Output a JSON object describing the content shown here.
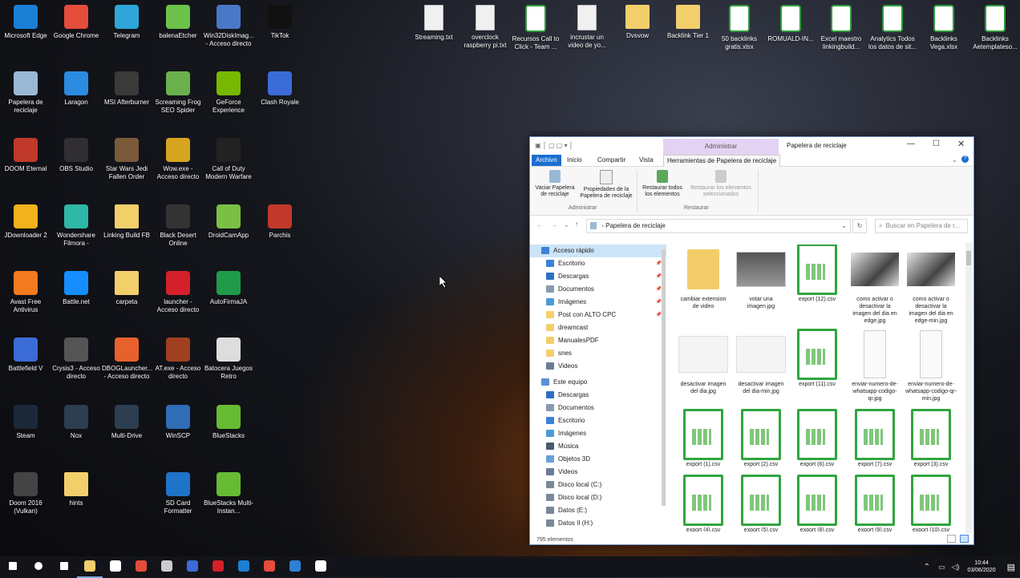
{
  "desktop": {
    "icons": [
      {
        "label": "Microsoft Edge",
        "icon": "edge-icon",
        "color": "#1b7fd6"
      },
      {
        "label": "Google Chrome",
        "icon": "chrome-icon",
        "color": "#e44c3c"
      },
      {
        "label": "Telegram",
        "icon": "telegram-icon",
        "color": "#2ea6da"
      },
      {
        "label": "balenaEtcher",
        "icon": "etcher-icon",
        "color": "#6cc24a"
      },
      {
        "label": "Win32DiskImag... - Acceso directo",
        "icon": "disk-imager-icon",
        "color": "#4a78c9"
      },
      {
        "label": "TikTok",
        "icon": "tiktok-icon",
        "color": "#111111"
      },
      {
        "label": "Papelera de reciclaje",
        "icon": "recycle-bin-icon",
        "color": "#9ab8d6"
      },
      {
        "label": "Laragon",
        "icon": "laragon-icon",
        "color": "#2b8be0"
      },
      {
        "label": "MSI Afterburner",
        "icon": "afterburner-icon",
        "color": "#3a3a3a"
      },
      {
        "label": "Screaming Frog SEO Spider",
        "icon": "screaming-frog-icon",
        "color": "#6ab04c"
      },
      {
        "label": "GeForce Experience",
        "icon": "geforce-icon",
        "color": "#76b900"
      },
      {
        "label": "Clash Royale",
        "icon": "clash-royale-icon",
        "color": "#3b6bd6"
      },
      {
        "label": "DOOM Eternal",
        "icon": "doom-icon",
        "color": "#c0392b"
      },
      {
        "label": "OBS Studio",
        "icon": "obs-icon",
        "color": "#302e31"
      },
      {
        "label": "Star Wars Jedi Fallen Order",
        "icon": "star-wars-icon",
        "color": "#7a5a3a"
      },
      {
        "label": "Wow.exe - Acceso directo",
        "icon": "wow-icon",
        "color": "#d6a520"
      },
      {
        "label": "Call of Duty Modern Warfare",
        "icon": "cod-icon",
        "color": "#222222"
      },
      {
        "label": "JDownloader 2",
        "icon": "jdownloader-icon",
        "color": "#f2b21b"
      },
      {
        "label": "Wondershare Filmora -",
        "icon": "filmora-icon",
        "color": "#2fb8a8"
      },
      {
        "label": "Linking Build FB",
        "icon": "folder-icon",
        "color": "#f3cf6c"
      },
      {
        "label": "Black Desert Online",
        "icon": "black-desert-icon",
        "color": "#333333"
      },
      {
        "label": "DroidCamApp",
        "icon": "droidcam-icon",
        "color": "#7cc043"
      },
      {
        "label": "Parchis",
        "icon": "parchis-icon",
        "color": "#c0392b"
      },
      {
        "label": "Avast Free Antivirus",
        "icon": "avast-icon",
        "color": "#f47a20"
      },
      {
        "label": "Battle.net",
        "icon": "battlenet-icon",
        "color": "#148eff"
      },
      {
        "label": "carpeta",
        "icon": "folder-icon",
        "color": "#f3cf6c"
      },
      {
        "label": "launcher - Acceso directo",
        "icon": "opera-icon",
        "color": "#d3202a"
      },
      {
        "label": "AutoFirmaJA",
        "icon": "autofirma-icon",
        "color": "#1f9b4a"
      },
      {
        "label": "Battlefield V",
        "icon": "battlefield-icon",
        "color": "#3b6bd6"
      },
      {
        "label": "Crysis3 - Acceso directo",
        "icon": "crysis-icon",
        "color": "#555555"
      },
      {
        "label": "DBOGLauncher... - Acceso directo",
        "icon": "dbog-icon",
        "color": "#e8612c"
      },
      {
        "label": "AT.exe - Acceso directo",
        "icon": "at-icon",
        "color": "#a04020"
      },
      {
        "label": "Batocera Juegos Retro",
        "icon": "batocera-icon",
        "color": "#dddddd"
      },
      {
        "label": "Steam",
        "icon": "steam-icon",
        "color": "#1b2838"
      },
      {
        "label": "Nox",
        "icon": "nox-icon",
        "color": "#2c3e50"
      },
      {
        "label": "Multi-Drive",
        "icon": "multidrive-icon",
        "color": "#2c3e50"
      },
      {
        "label": "WinSCP",
        "icon": "winscp-icon",
        "color": "#2f6db5"
      },
      {
        "label": "BlueStacks",
        "icon": "bluestacks-icon",
        "color": "#66bb33"
      },
      {
        "label": "Doom 2016 (Vulkan)",
        "icon": "doom2016-icon",
        "color": "#444444"
      },
      {
        "label": "hints",
        "icon": "folder-icon",
        "color": "#f3cf6c"
      },
      {
        "label": "SD Card Formatter",
        "icon": "sd-card-icon",
        "color": "#1f73c9"
      },
      {
        "label": "BlueStacks Multi-Instan...",
        "icon": "bluestacks-multi-icon",
        "color": "#66bb33"
      }
    ],
    "top_files": [
      {
        "label": "Streaming.txt",
        "kind": "doc"
      },
      {
        "label": "overclock raspberry pi.txt",
        "kind": "doc"
      },
      {
        "label": "Recursos Call to Click - Team ...",
        "kind": "xls"
      },
      {
        "label": "incrustar un video de yo...",
        "kind": "doc"
      },
      {
        "label": "Dvsvow",
        "kind": "fold"
      },
      {
        "label": "Backlink Tier 1",
        "kind": "fold"
      },
      {
        "label": "50 backlinks gratis.xlsx",
        "kind": "xls"
      },
      {
        "label": "ROMUALD-IN...",
        "kind": "xls"
      },
      {
        "label": "Excel maestro linkingbuild...",
        "kind": "xls"
      },
      {
        "label": "Analytics Todos los datos de sit...",
        "kind": "xls"
      },
      {
        "label": "Backlinks Vega.xlsx",
        "kind": "xls"
      },
      {
        "label": "Backlinks Aetemplateso...",
        "kind": "xls"
      }
    ]
  },
  "explorer": {
    "title": "Papelera de reciclaje",
    "context_tab_header": "Administrar",
    "ribbon_tabs": [
      "Archivo",
      "Inicio",
      "Compartir",
      "Vista",
      "Herramientas de Papelera de reciclaje"
    ],
    "ribbon_buttons": [
      {
        "label": "Vaciar Papelera de reciclaje"
      },
      {
        "label": "Propiedades de la Papelera de reciclaje"
      },
      {
        "label": "Restaurar todos los elementos"
      },
      {
        "label": "Restaurar los elementos seleccionados"
      }
    ],
    "ribbon_groups": [
      "Administrar",
      "Restaurar"
    ],
    "address": "Papelera de reciclaje",
    "search_placeholder": "Buscar en Papelera de r...",
    "nav": [
      {
        "label": "Acceso rápido",
        "indent": 0,
        "color": "#3b82d6",
        "pin": false
      },
      {
        "label": "Escritorio",
        "indent": 1,
        "color": "#3b82d6",
        "pin": true
      },
      {
        "label": "Descargas",
        "indent": 1,
        "color": "#2e6fc4",
        "pin": true
      },
      {
        "label": "Documentos",
        "indent": 1,
        "color": "#8a9bb0",
        "pin": true
      },
      {
        "label": "Imágenes",
        "indent": 1,
        "color": "#4b9cd6",
        "pin": true
      },
      {
        "label": "Post con ALTO CPC",
        "indent": 1,
        "color": "#f3cf6c",
        "pin": true
      },
      {
        "label": "dreamcast",
        "indent": 1,
        "color": "#f3cf6c",
        "pin": false
      },
      {
        "label": "ManualesPDF",
        "indent": 1,
        "color": "#f3cf6c",
        "pin": false
      },
      {
        "label": "snes",
        "indent": 1,
        "color": "#f3cf6c",
        "pin": false
      },
      {
        "label": "Videos",
        "indent": 1,
        "color": "#6a7c95",
        "pin": false
      },
      {
        "label": "Este equipo",
        "indent": 0,
        "color": "#5a8fd6",
        "pin": false
      },
      {
        "label": "Descargas",
        "indent": 1,
        "color": "#2e6fc4",
        "pin": false
      },
      {
        "label": "Documentos",
        "indent": 1,
        "color": "#8a9bb0",
        "pin": false
      },
      {
        "label": "Escritorio",
        "indent": 1,
        "color": "#3b82d6",
        "pin": false
      },
      {
        "label": "Imágenes",
        "indent": 1,
        "color": "#4b9cd6",
        "pin": false
      },
      {
        "label": "Música",
        "indent": 1,
        "color": "#4a5a70",
        "pin": false
      },
      {
        "label": "Objetos 3D",
        "indent": 1,
        "color": "#6aa0d8",
        "pin": false
      },
      {
        "label": "Videos",
        "indent": 1,
        "color": "#6a7c95",
        "pin": false
      },
      {
        "label": "Disco local (C:)",
        "indent": 1,
        "color": "#7a8899",
        "pin": false
      },
      {
        "label": "Disco local (D:)",
        "indent": 1,
        "color": "#7a8899",
        "pin": false
      },
      {
        "label": "Datos (E:)",
        "indent": 1,
        "color": "#7a8899",
        "pin": false
      },
      {
        "label": "Datos II (H:)",
        "indent": 1,
        "color": "#7a8899",
        "pin": false
      }
    ],
    "files": [
      {
        "label": "cambiar extension de video",
        "kind": "fold"
      },
      {
        "label": "votar una imagen.jpg",
        "kind": "img"
      },
      {
        "label": "export (12).csv",
        "kind": "xls"
      },
      {
        "label": "como activar o desactivar la imagen del dia en edge.jpg",
        "kind": "man"
      },
      {
        "label": "como activar o desactivar la imagen del dia en edge-min.jpg",
        "kind": "man"
      },
      {
        "label": "desactivar imagen del dia.jpg",
        "kind": "page"
      },
      {
        "label": "desactivar imagen del dia-min.jpg",
        "kind": "page"
      },
      {
        "label": "export (11).csv",
        "kind": "xls"
      },
      {
        "label": "enviar-numero-de-whatsapp-codigo-qr.jpg",
        "kind": "phone"
      },
      {
        "label": "enviar-numero-de-whatsapp-codigo-qr-min.jpg",
        "kind": "phone"
      },
      {
        "label": "export (1).csv",
        "kind": "xls"
      },
      {
        "label": "export (2).csv",
        "kind": "xls"
      },
      {
        "label": "export (6).csv",
        "kind": "xls"
      },
      {
        "label": "export (7).csv",
        "kind": "xls"
      },
      {
        "label": "export (3).csv",
        "kind": "xls"
      },
      {
        "label": "export (4).csv",
        "kind": "xls"
      },
      {
        "label": "export (5).csv",
        "kind": "xls"
      },
      {
        "label": "export (8).csv",
        "kind": "xls"
      },
      {
        "label": "export (9).csv",
        "kind": "xls"
      },
      {
        "label": "export (10).csv",
        "kind": "xls"
      }
    ],
    "status": "795 elementos"
  },
  "taskbar": {
    "items": [
      {
        "icon": "start-icon",
        "color": "#ffffff"
      },
      {
        "icon": "search-icon",
        "color": "#ffffff"
      },
      {
        "icon": "task-view-icon",
        "color": "#ffffff"
      },
      {
        "icon": "file-explorer-icon",
        "color": "#f3cf6c"
      },
      {
        "icon": "store-icon",
        "color": "#ffffff"
      },
      {
        "icon": "chrome-icon",
        "color": "#e44c3c"
      },
      {
        "icon": "hardware-icon",
        "color": "#cccccc"
      },
      {
        "icon": "monitor-icon",
        "color": "#3b6bd6"
      },
      {
        "icon": "opera-icon",
        "color": "#d3202a"
      },
      {
        "icon": "edge-icon",
        "color": "#1b7fd6"
      },
      {
        "icon": "chrome-alt-icon",
        "color": "#e44c3c"
      },
      {
        "icon": "photo-icon",
        "color": "#2f7fd6"
      },
      {
        "icon": "obs-icon",
        "color": "#ffffff"
      }
    ],
    "time": "10:44",
    "date": "03/06/2020"
  }
}
